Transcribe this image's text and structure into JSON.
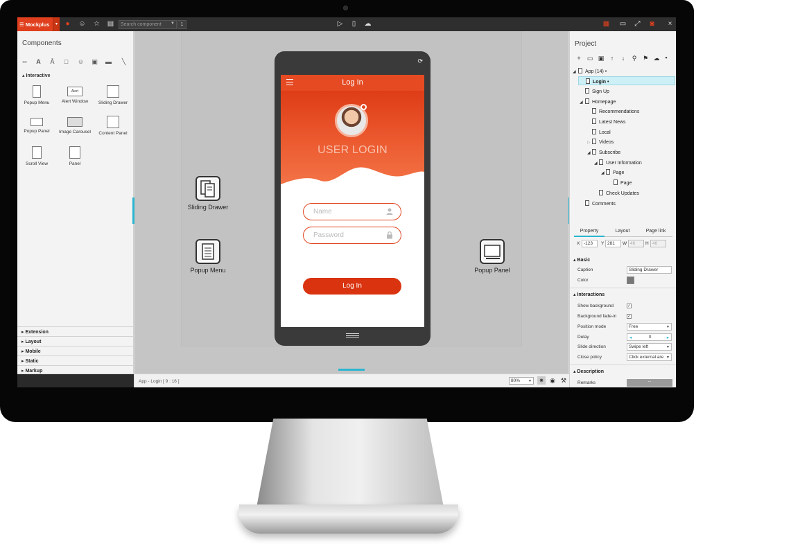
{
  "app": {
    "brand": "Mockplus",
    "toolbar_search_placeholder": "Search component",
    "toolbar_search_count": "1"
  },
  "left_panel": {
    "title": "Components",
    "interactive_header": "Interactive",
    "components": [
      "Popup Menu",
      "Alert Window",
      "Sliding Drawer",
      "Popup Panel",
      "Image Carousel",
      "Content Panel",
      "Scroll View",
      "Panel"
    ],
    "alert_thumb_text": "Alert",
    "categories": [
      "Extension",
      "Layout",
      "Mobile",
      "Static",
      "Markup"
    ]
  },
  "canvas": {
    "widgets": {
      "sliding_drawer": "Sliding Drawer",
      "popup_menu": "Popup Menu",
      "popup_panel": "Popup Panel"
    },
    "phone": {
      "header_title": "Log In",
      "hero_title": "USER LOGIN",
      "name_placeholder": "Name",
      "password_placeholder": "Password",
      "login_button": "Log In"
    },
    "accent_color": "#e0401e"
  },
  "statusbar": {
    "path": "App - Login [ 9 : 16 ]",
    "zoom": "80%"
  },
  "right_panel": {
    "title": "Project",
    "tree": {
      "app": "App (14)",
      "login": "Login",
      "sign_up": "Sign Up",
      "homepage": "Homepage",
      "recommendations": "Recommendations",
      "latest_news": "Latest News",
      "local": "Local",
      "videos": "Videos",
      "subscribe": "Subscribe",
      "user_information": "User Information",
      "page_1": "Page",
      "page_2": "Page",
      "check_updates": "Check Updates",
      "comments": "Comments"
    },
    "tabs": [
      "Property",
      "Layout",
      "Page link"
    ],
    "geometry": {
      "x_label": "X",
      "x_value": "-123",
      "y_label": "Y",
      "y_value": "281",
      "w_label": "W",
      "w_value": "46",
      "h_label": "H",
      "h_value": "46"
    },
    "basic": {
      "title": "Basic",
      "caption_label": "Caption",
      "caption_value": "Sliding Drawer",
      "color_label": "Color"
    },
    "interactions": {
      "title": "Interactions",
      "show_background": "Show background",
      "background_fade_in": "Background fade-in",
      "position_mode_label": "Position mode",
      "position_mode_value": "Free",
      "delay_label": "Delay",
      "delay_value": "0",
      "slide_direction_label": "Slide direction",
      "slide_direction_value": "Swipe left",
      "close_policy_label": "Close policy",
      "close_policy_value": "Click external are"
    },
    "description": {
      "title": "Description",
      "remarks_label": "Remarks",
      "remarks_button": "..."
    }
  }
}
